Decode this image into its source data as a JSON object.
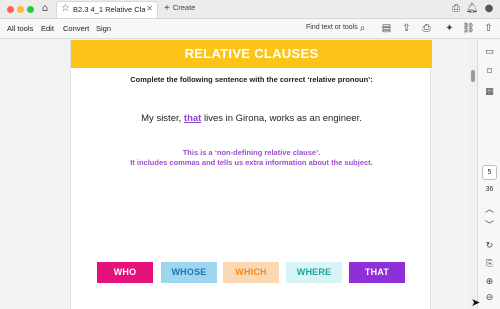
{
  "window": {
    "tab_title": "B2.3 4_1 Relative Claus...",
    "new_tab_label": "Create"
  },
  "toolbar": {
    "menu": [
      "All tools",
      "Edit",
      "Convert",
      "Sign"
    ],
    "find_label": "Find text or tools"
  },
  "slide": {
    "title": "RELATIVE CLAUSES",
    "instruction": "Complete the following sentence with the correct ‘relative pronoun’:",
    "sentence_before": "My sister, ",
    "sentence_answer": "that",
    "sentence_after": " lives in Girona, works as an engineer.",
    "explain_line1": "This is a ‘non-defining relative clause’.",
    "explain_line2": "It includes commas and tells us extra information about the subject.",
    "choices": [
      "WHO",
      "WHOSE",
      "WHICH",
      "WHERE",
      "THAT"
    ]
  },
  "pager": {
    "current_page": "5",
    "total_pages": "36"
  },
  "colors": {
    "banner": "#fcc419",
    "who": "#e6127b",
    "whose": "#9ed6f0",
    "which": "#fbd8b4",
    "where": "#d8f5f5",
    "that": "#8e2fd8",
    "explain_text": "#9b4fd0"
  },
  "icons": {
    "titlebar": [
      "home-icon",
      "star-icon",
      "close-icon",
      "plus-icon",
      "print-icon",
      "bell-icon",
      "user-icon"
    ],
    "toolbar": [
      "search-icon",
      "save-icon",
      "upload-icon",
      "print-icon",
      "ai-assistant-icon",
      "link-icon",
      "share-icon"
    ],
    "rail": [
      "comment-icon",
      "bookmark-icon",
      "pages-icon",
      "chevron-up-icon",
      "chevron-down-icon",
      "rotate-icon",
      "extract-icon",
      "zoom-in-icon",
      "zoom-out-icon"
    ]
  }
}
